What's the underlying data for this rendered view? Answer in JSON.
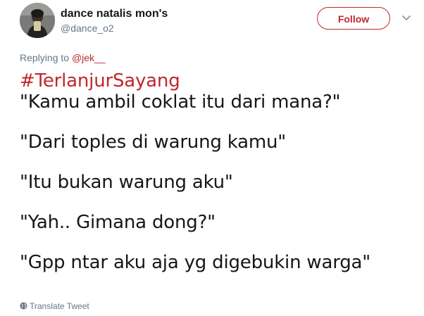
{
  "user": {
    "display_name": "dance natalis mon's",
    "username": "@dance_o2"
  },
  "follow_label": "Follow",
  "reply": {
    "prefix": "Replying to ",
    "mention": "@jek__"
  },
  "tweet": {
    "hashtag": "#TerlanjurSayang",
    "lines": [
      "\"Kamu ambil coklat itu dari mana?\"",
      "\"Dari toples di warung kamu\"",
      "\"Itu bukan warung aku\"",
      "\"Yah.. Gimana dong?\"",
      "\"Gpp ntar aku aja yg digebukin warga\""
    ]
  },
  "translate_label": "Translate Tweet",
  "icons": {
    "caret": "chevron-down-icon",
    "globe": "globe-icon"
  },
  "colors": {
    "accent": "#c0272d",
    "text": "#14171a",
    "secondary": "#657786"
  }
}
